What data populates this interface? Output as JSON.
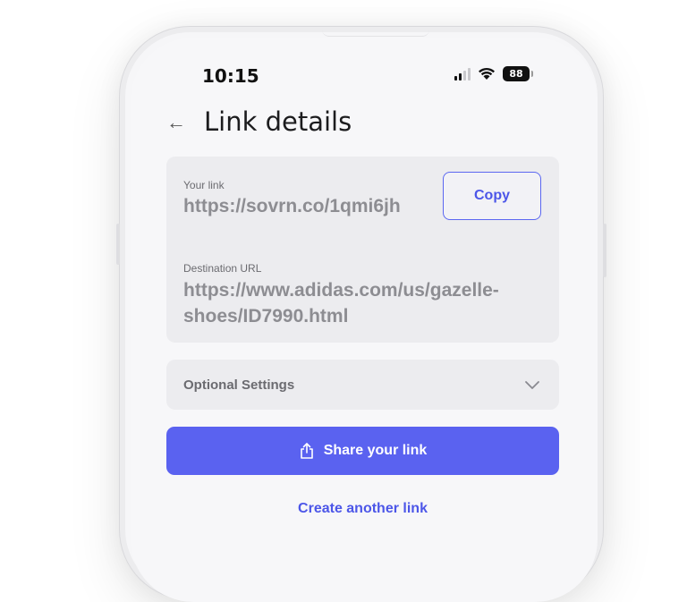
{
  "status_bar": {
    "time": "10:15",
    "battery": "88"
  },
  "header": {
    "title": "Link details"
  },
  "link_card": {
    "your_link_label": "Your link",
    "your_link_value": "https://sovrn.co/1qmi6jh",
    "copy_label": "Copy",
    "destination_label": "Destination URL",
    "destination_line1": "https://www.adidas.com/us/gazelle-",
    "destination_line2": "shoes/ID7990.html"
  },
  "optional_settings": {
    "label": "Optional Settings"
  },
  "actions": {
    "share_label": "Share your link",
    "create_another_label": "Create another link"
  },
  "colors": {
    "accent": "#5a62f0",
    "card_bg": "#ececef"
  }
}
